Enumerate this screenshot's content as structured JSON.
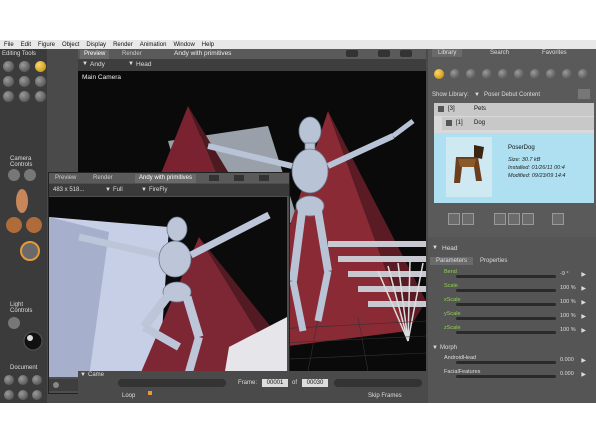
{
  "menu": [
    "File",
    "Edit",
    "Figure",
    "Object",
    "Display",
    "Render",
    "Animation",
    "Window",
    "Help"
  ],
  "left": {
    "editing_tools": "Editing Tools",
    "camera_controls": "Camera Controls",
    "light_controls": "Light Controls",
    "document": "Document"
  },
  "viewport": {
    "tabs": [
      "Preview",
      "Render"
    ],
    "doc_title": "Andy with primitives",
    "figure_select": "Andy",
    "part_select": "Head",
    "camera_label": "Main Camera"
  },
  "subwindow": {
    "tabs": [
      "Preview",
      "Render"
    ],
    "doc_title": "Andy with primitives",
    "size": "483 x 518...",
    "display": "Full",
    "renderer": "FireFly"
  },
  "timeline": {
    "camera_label": "Came",
    "frame_label": "Frame:",
    "frame_value": "00001",
    "of_label": "of",
    "total_frames": "00030",
    "loop": "Loop",
    "skip_frames": "Skip Frames"
  },
  "library": {
    "tabs": [
      "Library",
      "Search",
      "Favorites"
    ],
    "show_library_label": "Show Library:",
    "show_library_value": "Poser Debut Content",
    "folders": [
      {
        "count": "[3]",
        "name": "Pets"
      },
      {
        "count": "[1]",
        "name": "Dog"
      }
    ],
    "item": {
      "name": "PoserDog",
      "size": "Size: 30.7 kB",
      "installed": "Installed: 01/26/11 00:4",
      "modified": "Modified: 09/23/09 14:4"
    }
  },
  "head_panel": {
    "title": "Head",
    "tabs": [
      "Parameters",
      "Properties"
    ],
    "params": [
      {
        "name": "Bend",
        "value": "-9 °"
      },
      {
        "name": "Scale",
        "value": "100 %"
      },
      {
        "name": "xScale",
        "value": "100 %"
      },
      {
        "name": "yScale",
        "value": "100 %"
      },
      {
        "name": "zScale",
        "value": "100 %"
      }
    ],
    "morph_label": "Morph",
    "morphs": [
      {
        "name": "AndroidHead",
        "value": "0.000"
      },
      {
        "name": "FacialFeatures",
        "value": "0.000"
      }
    ]
  },
  "colors": {
    "accent": "#ffc21a",
    "selection": "#aee0f2",
    "param_label": "#8fd14f"
  }
}
